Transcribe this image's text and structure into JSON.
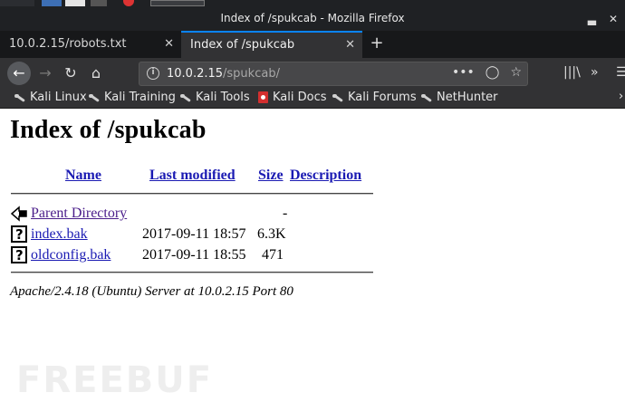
{
  "window": {
    "title": "Index of /spukcab - Mozilla Firefox"
  },
  "tabs": [
    {
      "label": "10.0.2.15/robots.txt",
      "active": false
    },
    {
      "label": "Index of /spukcab",
      "active": true
    }
  ],
  "nav": {
    "url_host": "10.0.2.15",
    "url_path": "/spukcab/"
  },
  "bookmarks": [
    {
      "label": "Kali Linux",
      "icon": "kali-dragon-icon"
    },
    {
      "label": "Kali Training",
      "icon": "kali-dragon-icon"
    },
    {
      "label": "Kali Tools",
      "icon": "kali-dragon-icon"
    },
    {
      "label": "Kali Docs",
      "icon": "kali-docs-icon"
    },
    {
      "label": "Kali Forums",
      "icon": "kali-dragon-icon"
    },
    {
      "label": "NetHunter",
      "icon": "nethunter-icon"
    }
  ],
  "listing": {
    "heading": "Index of /spukcab",
    "columns": {
      "name": "Name",
      "modified": "Last modified",
      "size": "Size",
      "description": "Description"
    },
    "rows": [
      {
        "name": "Parent Directory",
        "modified": "",
        "size": "-",
        "icon": "back-arrow-icon"
      },
      {
        "name": "index.bak",
        "modified": "2017-09-11 18:57",
        "size": "6.3K",
        "icon": "unknown-file-icon"
      },
      {
        "name": "oldconfig.bak",
        "modified": "2017-09-11 18:55",
        "size": "471",
        "icon": "unknown-file-icon"
      }
    ],
    "address": "Apache/2.4.18 (Ubuntu) Server at 10.0.2.15 Port 80"
  },
  "watermark": "FREEBUF"
}
